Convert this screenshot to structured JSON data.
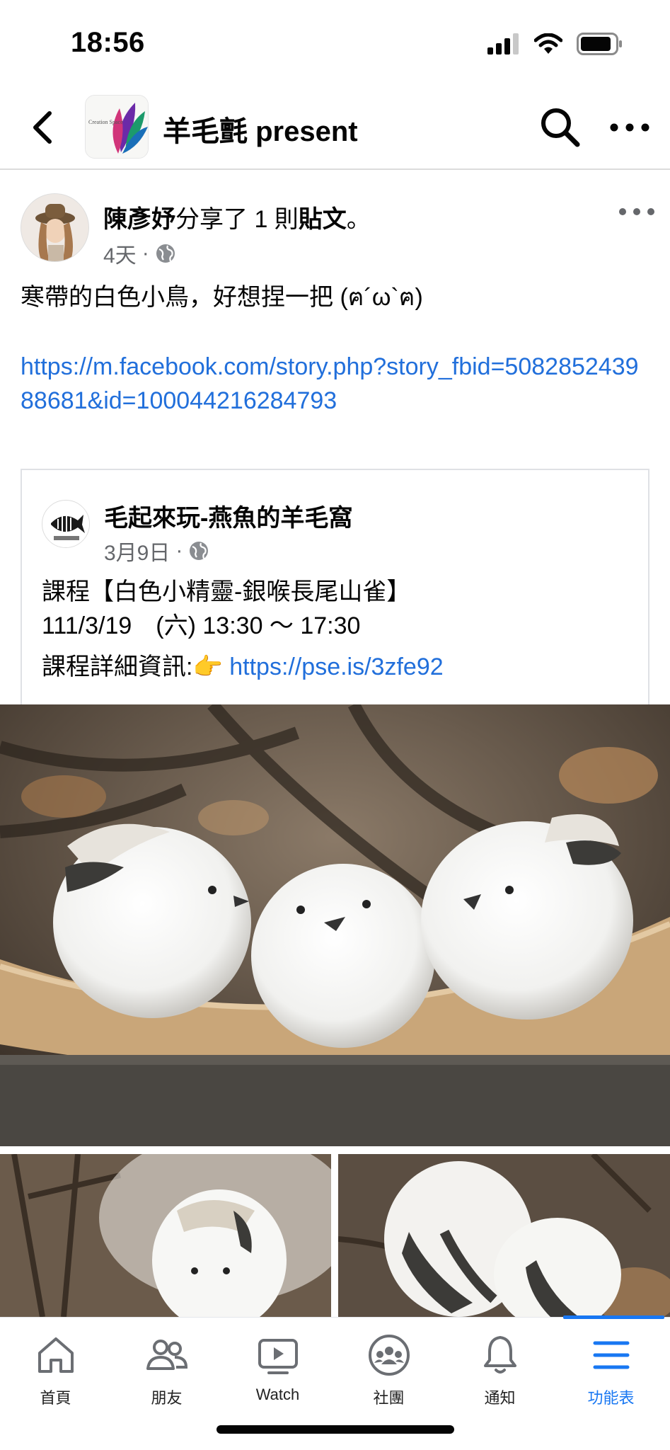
{
  "status_bar": {
    "time": "18:56"
  },
  "header": {
    "page_name": "羊毛氈 present",
    "avatar_caption": "Creation Space"
  },
  "post": {
    "author": "陳彥妤",
    "action_text": "分享了 1 則",
    "object_text": "貼文",
    "period": "。",
    "time_ago": "4天",
    "separator": "·",
    "text": "寒帶的白色小鳥，好想捏一把 (ฅ´ω`ฅ)",
    "link": "https://m.facebook.com/story.php?story_fbid=508285243988681&id=100044216284793"
  },
  "shared": {
    "page_name": "毛起來玩-燕魚的羊毛窩",
    "date": "3月9日",
    "separator": "·",
    "line1": "課程【白色小精靈-銀喉長尾山雀】",
    "line2": "111/3/19　(六) 13:30 ～ 17:30",
    "line3_label": "課程詳細資訊:👉 ",
    "line3_link": "https://pse.is/3zfe92"
  },
  "tabs": [
    {
      "label": "首頁",
      "icon": "home-icon"
    },
    {
      "label": "朋友",
      "icon": "friends-icon"
    },
    {
      "label": "Watch",
      "icon": "watch-icon"
    },
    {
      "label": "社團",
      "icon": "groups-icon"
    },
    {
      "label": "通知",
      "icon": "bell-icon"
    },
    {
      "label": "功能表",
      "icon": "menu-icon",
      "active": true
    }
  ],
  "colors": {
    "accent": "#1877f2",
    "link": "#216fdb",
    "muted": "#65676b"
  }
}
